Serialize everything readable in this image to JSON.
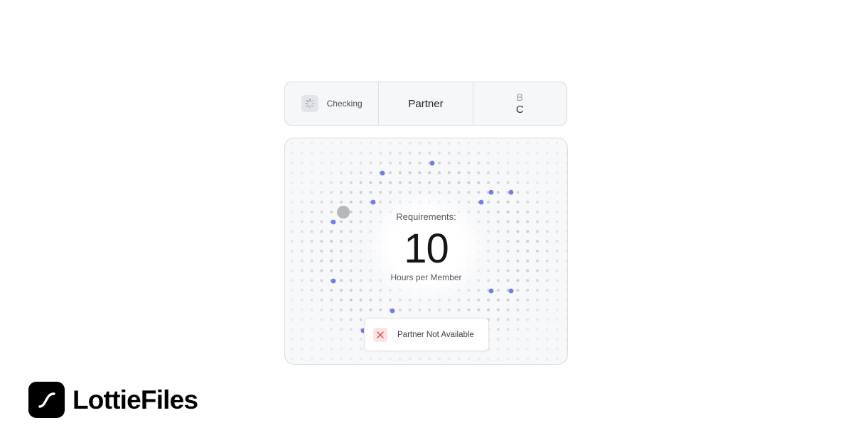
{
  "tabs": {
    "checking": {
      "label": "Checking",
      "icon": "spinner-icon"
    },
    "partner": {
      "label": "Partner"
    },
    "roller": {
      "previous": "B",
      "current": "C"
    }
  },
  "requirements": {
    "label": "Requirements:",
    "value": "10",
    "unit": "Hours  per Member"
  },
  "status": {
    "label": "Partner Not Available",
    "icon": "close-icon",
    "icon_color": "#e5484d",
    "icon_bg": "#fde4e1"
  },
  "brand": {
    "name": "LottieFiles",
    "icon": "lottie-logo-icon"
  },
  "colors": {
    "accent_dot": "#6f7cf0",
    "muted_dot": "#b9bbc2",
    "panel_bg": "#f7f8fa"
  }
}
